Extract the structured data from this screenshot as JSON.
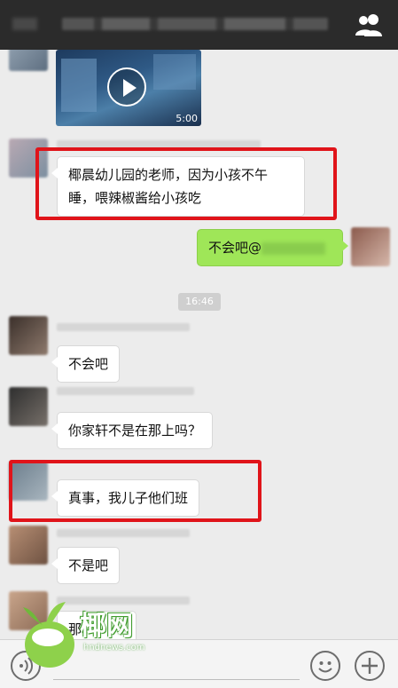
{
  "header": {
    "icon": "contacts-icon"
  },
  "chat": {
    "video": {
      "duration": "5:00"
    },
    "messages": [
      {
        "side": "left",
        "text": "椰晨幼儿园的老师，因为小孩不午睡，喂辣椒酱给小孩吃"
      },
      {
        "side": "right",
        "text": "不会吧@"
      },
      {
        "side": "left",
        "text": "不会吧"
      },
      {
        "side": "left",
        "text": "你家轩不是在那上吗？"
      },
      {
        "side": "left",
        "text": "真事，我儿子他们班"
      },
      {
        "side": "left",
        "text": "不是吧"
      },
      {
        "side": "left",
        "text": "那"
      }
    ],
    "timestamp": "16:46"
  },
  "input_bar": {
    "left_icon": "voice-icon",
    "emoji_icon": "emoji-icon",
    "plus_icon": "plus-icon"
  },
  "watermark": {
    "text": "椰网",
    "url": "hndnews.com"
  },
  "colors": {
    "topbar": "#2b2b2b",
    "background": "#ececec",
    "outgoing_bubble": "#9fe658",
    "highlight_box": "#e0141a"
  }
}
